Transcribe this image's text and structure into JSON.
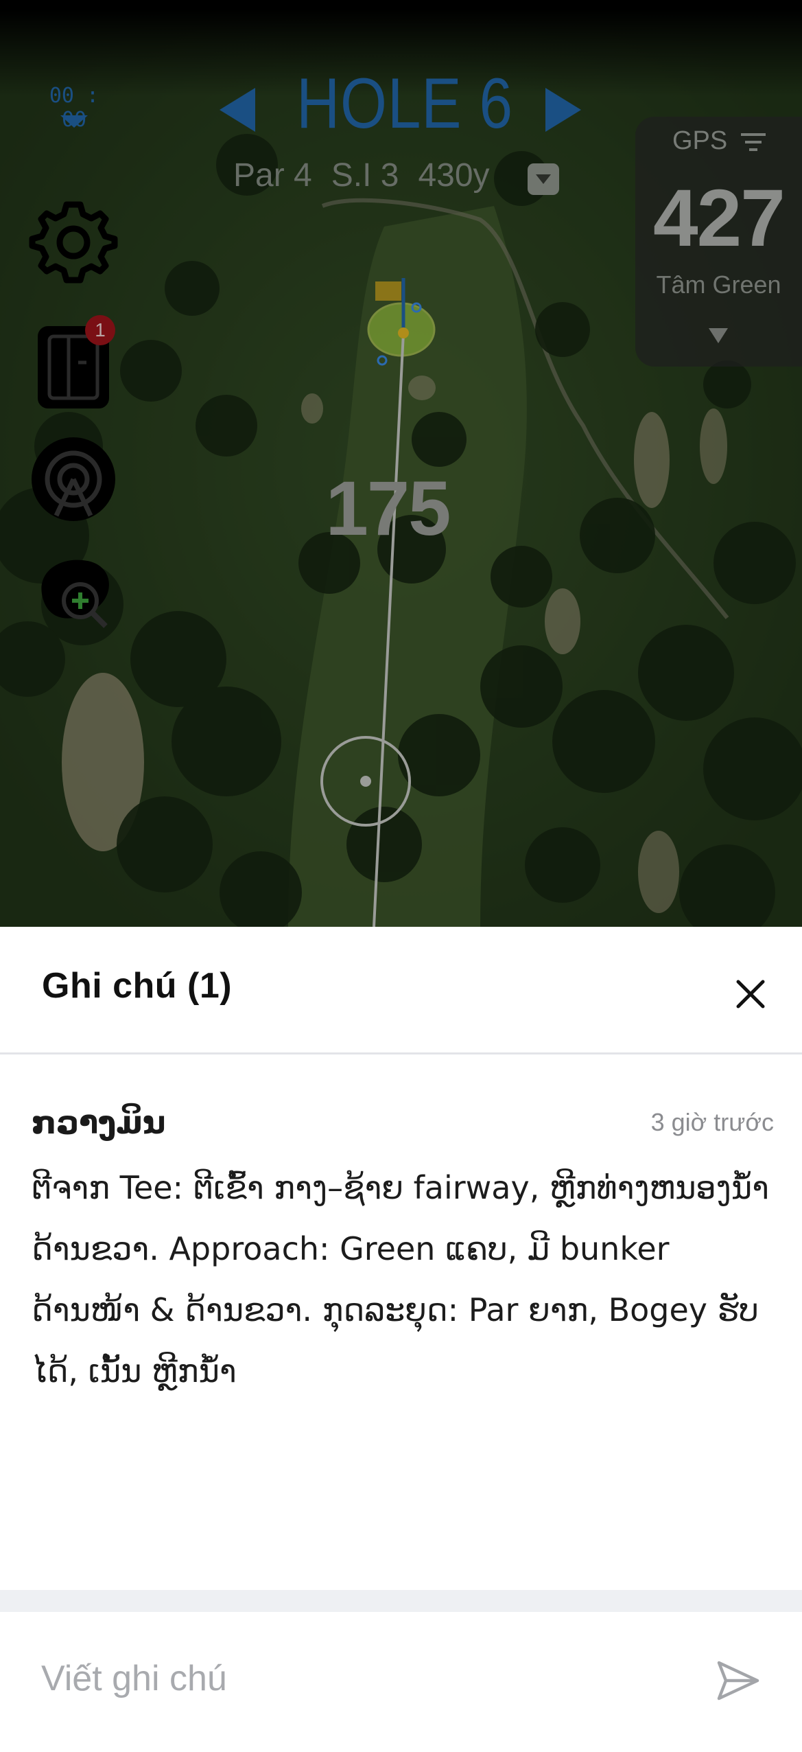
{
  "hud": {
    "timer": "00 : 00",
    "hole_title": "HOLE 6",
    "par": "Par 4",
    "stroke_index": "S.I 3",
    "length": "430y",
    "notes_badge": "1",
    "plays_like_distance": "175"
  },
  "gps": {
    "label": "GPS",
    "distance": "427",
    "target": "Tâm Green"
  },
  "colors": {
    "accent_blue": "#1a4f83",
    "badge_red": "#7a0f14",
    "flag_yellow": "#c8a014",
    "green_fill": "#9ec93a"
  },
  "icons": {
    "settings": "gear-icon",
    "scorecard": "scorecard-icon",
    "signal": "tracker-signal-icon",
    "zoom": "map-zoom-icon",
    "close": "close-icon",
    "send": "send-icon",
    "filter": "filter-icon"
  },
  "notes": {
    "title": "Ghi chú (1)",
    "items": [
      {
        "author": "ກວາງມິນ",
        "time": "3 giờ trước",
        "text": "ຕີຈາກ Tee: ຕີເຂົ້າ ກາງ–ຊ້າຍ fairway, ຫຼີກທ່າງຫນອງນໍ້າດ້ານຂວາ. Approach: Green ແຄບ, ມີ bunker ດ້ານໜ້າ & ດ້ານຂວາ. ກຸດລະຍຸດ: Par ຍາກ, Bogey ຮັບໄດ້, ເນັ້ນ ຫຼີກນໍ້າ"
      }
    ],
    "composer_placeholder": "Viết ghi chú"
  }
}
